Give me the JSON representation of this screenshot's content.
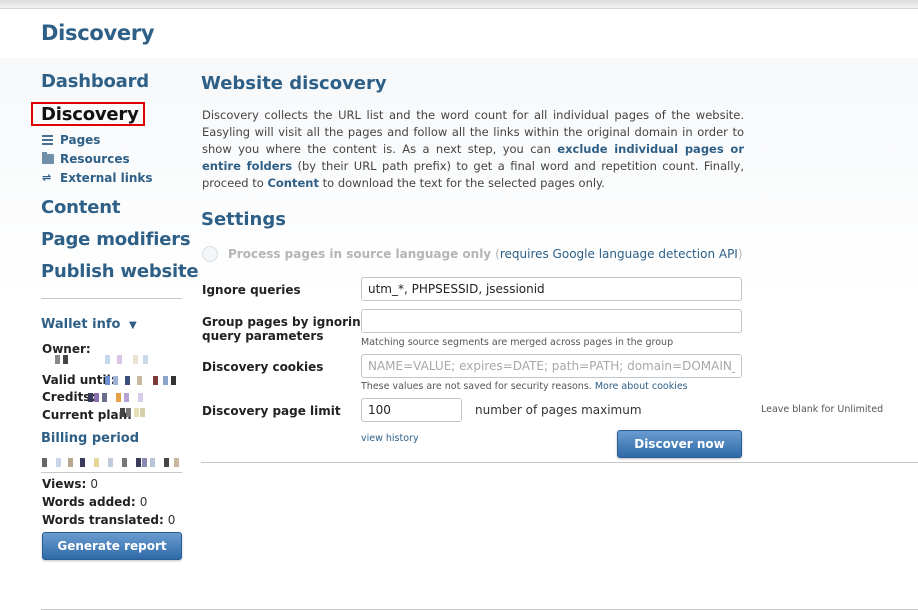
{
  "page": {
    "title": "Discovery"
  },
  "sidebar": {
    "nav": [
      {
        "label": "Dashboard"
      },
      {
        "label": "Discovery"
      },
      {
        "label": "Content"
      },
      {
        "label": "Page modifiers"
      },
      {
        "label": "Publish website"
      }
    ],
    "sub": [
      {
        "label": "Pages",
        "icon": "list-icon"
      },
      {
        "label": "Resources",
        "icon": "folder-icon"
      },
      {
        "label": "External links",
        "icon": "link-icon"
      }
    ]
  },
  "wallet": {
    "title": "Wallet info",
    "toggle_icon": "caret-down-icon",
    "owner_label": "Owner:",
    "valid_until_label": "Valid until:",
    "credits_label": "Credits:",
    "current_plan_label": "Current plan:",
    "billing_title": "Billing period",
    "views_label": "Views:",
    "views_value": "0",
    "words_added_label": "Words added:",
    "words_added_value": "0",
    "words_translated_label": "Words translated:",
    "words_translated_value": "0",
    "generate_report_label": "Generate report"
  },
  "main": {
    "heading": "Website discovery",
    "description": {
      "part1": "Discovery collects the URL list and the word count for all individual pages of the website. Easyling will visit all the pages and follow all the links within the original domain in order to show you where the content is. As a next step, you can ",
      "link1": "exclude individual pages or entire folders",
      "part2": " (by their URL path prefix) to get a final word and repetition count. Finally, proceed to ",
      "link2": "Content",
      "part3": " to download the text for the selected pages only."
    },
    "settings_heading": "Settings",
    "process_source_label": "Process pages in source language only",
    "process_source_paren_open": "(",
    "process_source_link": "requires Google language detection API",
    "process_source_paren_close": ")",
    "ignore_queries_label": "Ignore queries",
    "ignore_queries_value": "utm_*, PHPSESSID, jsessionid",
    "group_pages_label_1": "Group pages by ignoring",
    "group_pages_label_2": "query parameters",
    "group_pages_value": "",
    "group_pages_hint": "Matching source segments are merged across pages in the group",
    "cookies_label": "Discovery cookies",
    "cookies_placeholder": "NAME=VALUE; expires=DATE; path=PATH; domain=DOMAIN_NAME",
    "cookies_hint": "These values are not saved for security reasons.",
    "cookies_hint_link": "More about cookies",
    "page_limit_label": "Discovery page limit",
    "page_limit_value": "100",
    "page_limit_unit": "number of pages maximum",
    "page_limit_hint": "Leave blank for Unlimited",
    "view_history_label": "view history",
    "discover_now_label": "Discover now"
  },
  "colors": {
    "accent": "#2e5f86",
    "highlight": "#e00000",
    "button_top": "#6a9cd0",
    "button_bottom": "#2f6aa8"
  }
}
